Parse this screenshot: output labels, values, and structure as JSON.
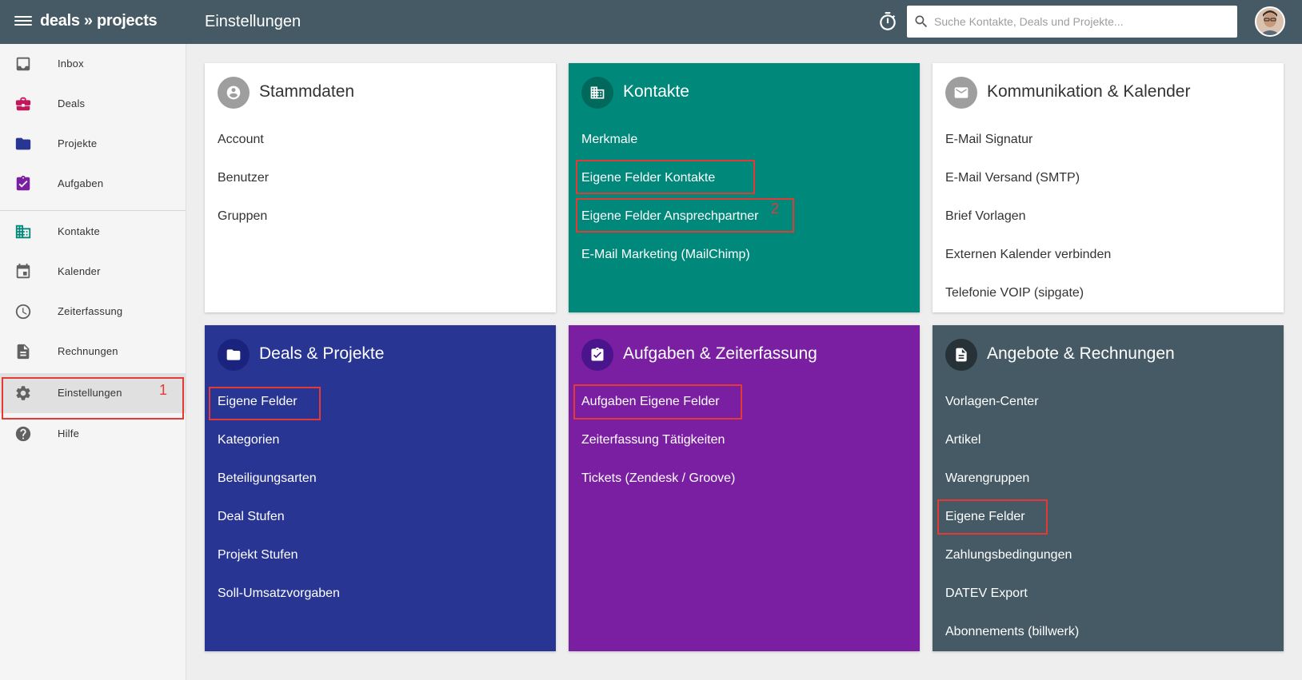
{
  "app": {
    "logo": "deals » projects",
    "page_title": "Einstellungen"
  },
  "search": {
    "placeholder": "Suche Kontakte, Deals und Projekte..."
  },
  "sidebar": {
    "items": [
      {
        "label": "Inbox",
        "icon": "inbox-icon"
      },
      {
        "label": "Deals",
        "icon": "briefcase-icon"
      },
      {
        "label": "Projekte",
        "icon": "folder-icon"
      },
      {
        "label": "Aufgaben",
        "icon": "clipboard-check-icon"
      },
      {
        "label": "Kontakte",
        "icon": "building-icon"
      },
      {
        "label": "Kalender",
        "icon": "calendar-icon"
      },
      {
        "label": "Zeiterfassung",
        "icon": "clock-icon"
      },
      {
        "label": "Rechnungen",
        "icon": "document-icon"
      },
      {
        "label": "Einstellungen",
        "icon": "gear-icon"
      },
      {
        "label": "Hilfe",
        "icon": "help-icon"
      }
    ],
    "annotation": "1"
  },
  "cards": {
    "stammdaten": {
      "title": "Stammdaten",
      "links": [
        "Account",
        "Benutzer",
        "Gruppen"
      ]
    },
    "kontakte": {
      "title": "Kontakte",
      "links": [
        "Merkmale",
        "Eigene Felder Kontakte",
        "Eigene Felder Ansprechpartner",
        "E-Mail Marketing (MailChimp)"
      ],
      "annotation": "2"
    },
    "kommunikation": {
      "title": "Kommunikation & Kalender",
      "links": [
        "E-Mail Signatur",
        "E-Mail Versand (SMTP)",
        "Brief Vorlagen",
        "Externen Kalender verbinden",
        "Telefonie VOIP (sipgate)"
      ]
    },
    "deals": {
      "title": "Deals & Projekte",
      "links": [
        "Eigene Felder",
        "Kategorien",
        "Beteiligungsarten",
        "Deal Stufen",
        "Projekt Stufen",
        "Soll-Umsatzvorgaben"
      ]
    },
    "aufgaben": {
      "title": "Aufgaben & Zeiterfassung",
      "links": [
        "Aufgaben Eigene Felder",
        "Zeiterfassung Tätigkeiten",
        "Tickets (Zendesk / Groove)"
      ]
    },
    "angebote": {
      "title": "Angebote & Rechnungen",
      "links": [
        "Vorlagen-Center",
        "Artikel",
        "Warengruppen",
        "Eigene Felder",
        "Zahlungsbedingungen",
        "DATEV Export",
        "Abonnements (billwerk)"
      ]
    }
  },
  "colors": {
    "topbar": "#455a64",
    "teal": "#00897b",
    "blue": "#283593",
    "purple": "#7b1fa2",
    "slate": "#455a64",
    "highlight": "#e53935"
  }
}
